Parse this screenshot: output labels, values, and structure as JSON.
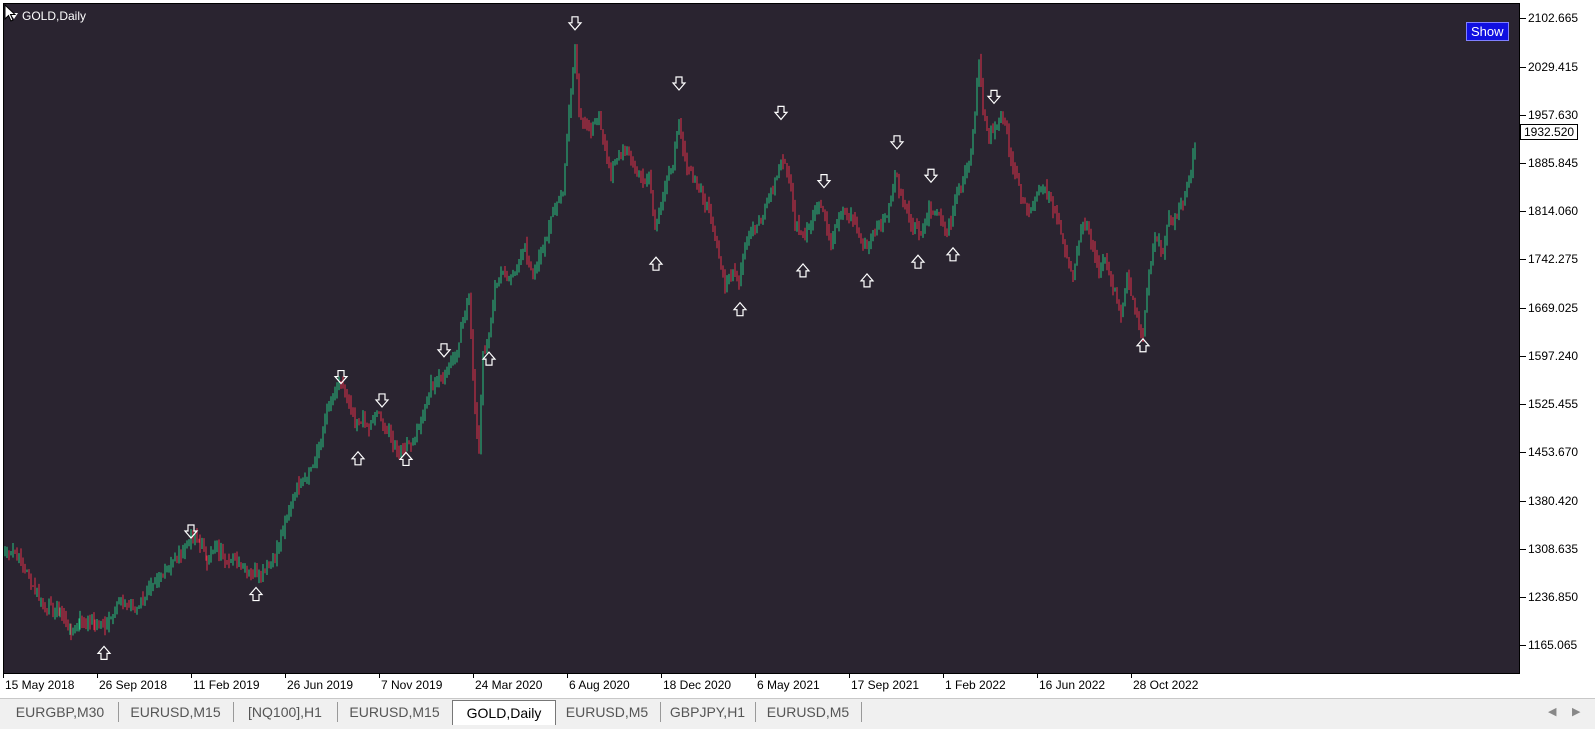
{
  "window": {
    "symbol_label": "GOLD,Daily",
    "show_button": "Show"
  },
  "colors": {
    "background": "#2a2430",
    "bull": "#26c281",
    "bear": "#e0304a",
    "arrow": "#ffffff",
    "button": "#1010e0"
  },
  "price_axis": {
    "labels": [
      "2102.665",
      "2029.415",
      "1957.630",
      "1885.845",
      "1814.060",
      "1742.275",
      "1669.025",
      "1597.240",
      "1525.455",
      "1453.670",
      "1380.420",
      "1308.635",
      "1236.850",
      "1165.065"
    ],
    "current_price": "1932.520"
  },
  "time_axis": {
    "labels": [
      "15 May 2018",
      "26 Sep 2018",
      "11 Feb 2019",
      "26 Jun 2019",
      "7 Nov 2019",
      "24 Mar 2020",
      "6 Aug 2020",
      "18 Dec 2020",
      "6 May 2021",
      "17 Sep 2021",
      "1 Feb 2022",
      "16 Jun 2022",
      "28 Oct 2022"
    ]
  },
  "chart_data": {
    "type": "candlestick",
    "title": "GOLD,Daily",
    "ylim": [
      1140,
      2120
    ],
    "price_path": [
      [
        0,
        1305
      ],
      [
        8,
        1310
      ],
      [
        20,
        1280
      ],
      [
        30,
        1250
      ],
      [
        40,
        1225
      ],
      [
        55,
        1215
      ],
      [
        66,
        1185
      ],
      [
        75,
        1205
      ],
      [
        90,
        1200
      ],
      [
        100,
        1195
      ],
      [
        110,
        1225
      ],
      [
        120,
        1230
      ],
      [
        130,
        1220
      ],
      [
        140,
        1240
      ],
      [
        150,
        1255
      ],
      [
        160,
        1280
      ],
      [
        170,
        1295
      ],
      [
        180,
        1310
      ],
      [
        186,
        1330
      ],
      [
        195,
        1320
      ],
      [
        202,
        1295
      ],
      [
        210,
        1310
      ],
      [
        220,
        1300
      ],
      [
        230,
        1290
      ],
      [
        240,
        1285
      ],
      [
        250,
        1275
      ],
      [
        260,
        1280
      ],
      [
        270,
        1300
      ],
      [
        280,
        1345
      ],
      [
        290,
        1400
      ],
      [
        300,
        1420
      ],
      [
        310,
        1440
      ],
      [
        316,
        1475
      ],
      [
        322,
        1515
      ],
      [
        330,
        1545
      ],
      [
        336,
        1560
      ],
      [
        342,
        1535
      ],
      [
        350,
        1495
      ],
      [
        356,
        1505
      ],
      [
        364,
        1490
      ],
      [
        372,
        1515
      ],
      [
        378,
        1495
      ],
      [
        386,
        1475
      ],
      [
        394,
        1460
      ],
      [
        402,
        1465
      ],
      [
        410,
        1480
      ],
      [
        418,
        1510
      ],
      [
        426,
        1555
      ],
      [
        434,
        1565
      ],
      [
        442,
        1580
      ],
      [
        450,
        1600
      ],
      [
        458,
        1650
      ],
      [
        464,
        1690
      ],
      [
        470,
        1520
      ],
      [
        474,
        1460
      ],
      [
        478,
        1600
      ],
      [
        484,
        1630
      ],
      [
        490,
        1700
      ],
      [
        496,
        1720
      ],
      [
        504,
        1710
      ],
      [
        512,
        1735
      ],
      [
        520,
        1760
      ],
      [
        528,
        1720
      ],
      [
        536,
        1750
      ],
      [
        544,
        1790
      ],
      [
        552,
        1830
      ],
      [
        558,
        1850
      ],
      [
        564,
        1960
      ],
      [
        570,
        2060
      ],
      [
        574,
        1970
      ],
      [
        580,
        1940
      ],
      [
        586,
        1930
      ],
      [
        592,
        1960
      ],
      [
        600,
        1920
      ],
      [
        606,
        1870
      ],
      [
        614,
        1900
      ],
      [
        622,
        1910
      ],
      [
        630,
        1880
      ],
      [
        638,
        1860
      ],
      [
        644,
        1870
      ],
      [
        650,
        1790
      ],
      [
        656,
        1830
      ],
      [
        662,
        1860
      ],
      [
        668,
        1890
      ],
      [
        674,
        1945
      ],
      [
        680,
        1890
      ],
      [
        688,
        1870
      ],
      [
        696,
        1840
      ],
      [
        704,
        1820
      ],
      [
        712,
        1770
      ],
      [
        720,
        1700
      ],
      [
        728,
        1730
      ],
      [
        734,
        1710
      ],
      [
        740,
        1770
      ],
      [
        748,
        1790
      ],
      [
        756,
        1800
      ],
      [
        764,
        1840
      ],
      [
        770,
        1860
      ],
      [
        778,
        1895
      ],
      [
        784,
        1870
      ],
      [
        790,
        1800
      ],
      [
        798,
        1780
      ],
      [
        806,
        1800
      ],
      [
        814,
        1830
      ],
      [
        820,
        1810
      ],
      [
        826,
        1760
      ],
      [
        832,
        1800
      ],
      [
        840,
        1815
      ],
      [
        848,
        1800
      ],
      [
        856,
        1770
      ],
      [
        862,
        1760
      ],
      [
        868,
        1785
      ],
      [
        876,
        1800
      ],
      [
        884,
        1820
      ],
      [
        890,
        1870
      ],
      [
        898,
        1830
      ],
      [
        906,
        1800
      ],
      [
        914,
        1780
      ],
      [
        920,
        1800
      ],
      [
        926,
        1820
      ],
      [
        934,
        1810
      ],
      [
        940,
        1790
      ],
      [
        946,
        1800
      ],
      [
        952,
        1840
      ],
      [
        958,
        1860
      ],
      [
        964,
        1890
      ],
      [
        970,
        1960
      ],
      [
        974,
        2040
      ],
      [
        978,
        1960
      ],
      [
        984,
        1930
      ],
      [
        990,
        1940
      ],
      [
        996,
        1960
      ],
      [
        1002,
        1930
      ],
      [
        1008,
        1880
      ],
      [
        1016,
        1840
      ],
      [
        1024,
        1810
      ],
      [
        1032,
        1840
      ],
      [
        1040,
        1850
      ],
      [
        1048,
        1820
      ],
      [
        1054,
        1800
      ],
      [
        1060,
        1760
      ],
      [
        1068,
        1720
      ],
      [
        1076,
        1790
      ],
      [
        1082,
        1800
      ],
      [
        1088,
        1760
      ],
      [
        1094,
        1730
      ],
      [
        1100,
        1740
      ],
      [
        1108,
        1700
      ],
      [
        1116,
        1660
      ],
      [
        1122,
        1720
      ],
      [
        1128,
        1680
      ],
      [
        1134,
        1640
      ],
      [
        1138,
        1630
      ],
      [
        1144,
        1720
      ],
      [
        1150,
        1770
      ],
      [
        1158,
        1760
      ],
      [
        1164,
        1800
      ],
      [
        1172,
        1810
      ],
      [
        1180,
        1840
      ],
      [
        1186,
        1880
      ],
      [
        1192,
        1930
      ]
    ],
    "fractal_down_arrows": [
      [
        187,
        1334
      ],
      [
        337,
        1565
      ],
      [
        378,
        1530
      ],
      [
        440,
        1605
      ],
      [
        571,
        2094
      ],
      [
        675,
        2004
      ],
      [
        777,
        1960
      ],
      [
        820,
        1858
      ],
      [
        893,
        1916
      ],
      [
        927,
        1866
      ],
      [
        990,
        1984
      ]
    ],
    "fractal_up_arrows": [
      [
        100,
        1157
      ],
      [
        252,
        1245
      ],
      [
        354,
        1448
      ],
      [
        402,
        1447
      ],
      [
        485,
        1597
      ],
      [
        652,
        1739
      ],
      [
        736,
        1671
      ],
      [
        799,
        1729
      ],
      [
        863,
        1714
      ],
      [
        914,
        1742
      ],
      [
        949,
        1753
      ],
      [
        1139,
        1617
      ]
    ]
  },
  "tabs": [
    {
      "label": "EURGBP,M30",
      "active": false
    },
    {
      "label": "EURUSD,M15",
      "active": false
    },
    {
      "label": "[NQ100],H1",
      "active": false
    },
    {
      "label": "EURUSD,M15",
      "active": false
    },
    {
      "label": "GOLD,Daily",
      "active": true
    },
    {
      "label": "EURUSD,M5",
      "active": false
    },
    {
      "label": "GBPJPY,H1",
      "active": false
    },
    {
      "label": "EURUSD,M5",
      "active": false
    }
  ]
}
